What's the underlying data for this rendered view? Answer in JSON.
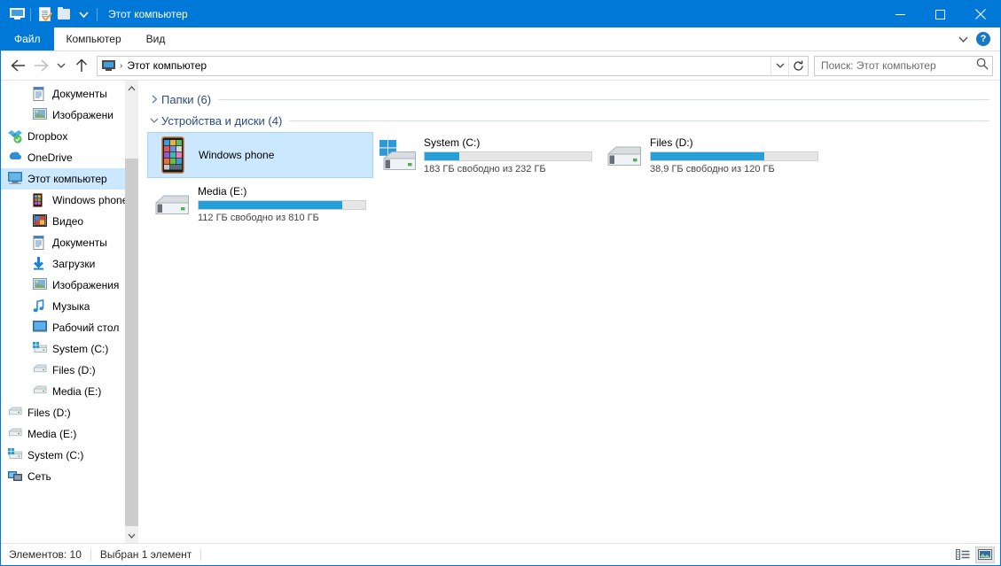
{
  "window": {
    "title": "Этот компьютер",
    "quick_access": [
      "computer-icon",
      "properties-icon",
      "new-folder-icon",
      "customize-chevron-icon"
    ],
    "controls": {
      "minimize": "—",
      "maximize": "▢",
      "close": "✕"
    }
  },
  "ribbon": {
    "tabs": [
      {
        "label": "Файл",
        "active": true
      },
      {
        "label": "Компьютер",
        "active": false
      },
      {
        "label": "Вид",
        "active": false
      }
    ],
    "collapse_icon": "chevron-down-icon",
    "help_label": "?"
  },
  "address": {
    "back_icon": "arrow-left-icon",
    "forward_icon": "arrow-right-icon",
    "recent_icon": "chevron-down-icon",
    "up_icon": "arrow-up-icon",
    "crumb_icon": "computer-icon",
    "path": "Этот компьютер",
    "separator": "›",
    "dropdown_icon": "chevron-down-icon",
    "refresh_icon": "refresh-icon"
  },
  "search": {
    "placeholder": "Поиск: Этот компьютер",
    "icon": "search-icon"
  },
  "sidebar": {
    "items": [
      {
        "label": "Документы",
        "icon": "documents-icon",
        "indent": "ind-1",
        "pinned": true,
        "selected": false
      },
      {
        "label": "Изображени",
        "icon": "pictures-icon",
        "indent": "ind-1",
        "pinned": true,
        "selected": false
      },
      {
        "label": "Dropbox",
        "icon": "dropbox-icon",
        "indent": "ind-top",
        "pinned": false,
        "selected": false
      },
      {
        "label": "OneDrive",
        "icon": "onedrive-icon",
        "indent": "ind-top",
        "pinned": false,
        "selected": false
      },
      {
        "label": "Этот компьютер",
        "icon": "computer-icon",
        "indent": "ind-top",
        "pinned": false,
        "selected": true
      },
      {
        "label": "Windows phone",
        "icon": "phone-icon",
        "indent": "ind-1",
        "pinned": false,
        "selected": false
      },
      {
        "label": "Видео",
        "icon": "video-icon",
        "indent": "ind-1",
        "pinned": false,
        "selected": false
      },
      {
        "label": "Документы",
        "icon": "documents-icon",
        "indent": "ind-1",
        "pinned": false,
        "selected": false
      },
      {
        "label": "Загрузки",
        "icon": "downloads-icon",
        "indent": "ind-1",
        "pinned": false,
        "selected": false
      },
      {
        "label": "Изображения",
        "icon": "pictures-icon",
        "indent": "ind-1",
        "pinned": false,
        "selected": false
      },
      {
        "label": "Музыка",
        "icon": "music-icon",
        "indent": "ind-1",
        "pinned": false,
        "selected": false
      },
      {
        "label": "Рабочий стол",
        "icon": "desktop-icon",
        "indent": "ind-1",
        "pinned": false,
        "selected": false
      },
      {
        "label": "System (C:)",
        "icon": "windows-drive-icon",
        "indent": "ind-1",
        "pinned": false,
        "selected": false
      },
      {
        "label": "Files (D:)",
        "icon": "drive-icon",
        "indent": "ind-1",
        "pinned": false,
        "selected": false
      },
      {
        "label": "Media (E:)",
        "icon": "drive-icon",
        "indent": "ind-1",
        "pinned": false,
        "selected": false
      },
      {
        "label": "Files (D:)",
        "icon": "drive-icon",
        "indent": "ind-top",
        "pinned": false,
        "selected": false
      },
      {
        "label": "Media (E:)",
        "icon": "drive-icon",
        "indent": "ind-top",
        "pinned": false,
        "selected": false
      },
      {
        "label": "System (C:)",
        "icon": "windows-drive-icon",
        "indent": "ind-top",
        "pinned": false,
        "selected": false
      },
      {
        "label": "Сеть",
        "icon": "network-icon",
        "indent": "ind-top",
        "pinned": false,
        "selected": false
      }
    ],
    "scroll_up_icon": "chevron-up-icon",
    "scroll_down_icon": "chevron-down-icon"
  },
  "main": {
    "groups": [
      {
        "title": "Папки (6)",
        "expanded": false,
        "chevron": "chevron-right-icon"
      },
      {
        "title": "Устройства и диски (4)",
        "expanded": true,
        "chevron": "chevron-down-icon"
      }
    ],
    "devices": [
      {
        "name": "Windows phone",
        "icon": "phone-icon",
        "selected": true,
        "has_bar": false,
        "capacity_text": ""
      },
      {
        "name": "System (C:)",
        "icon": "windows-drive-icon",
        "selected": false,
        "has_bar": true,
        "used_percent": 21,
        "capacity_text": "183 ГБ свободно из 232 ГБ"
      },
      {
        "name": "Files (D:)",
        "icon": "drive-icon",
        "selected": false,
        "has_bar": true,
        "used_percent": 68,
        "capacity_text": "38,9 ГБ свободно из 120 ГБ"
      },
      {
        "name": "Media (E:)",
        "icon": "drive-icon",
        "selected": false,
        "has_bar": true,
        "used_percent": 86,
        "capacity_text": "112 ГБ свободно из 810 ГБ"
      }
    ]
  },
  "status": {
    "item_count": "Элементов: 10",
    "selection": "Выбран 1 элемент",
    "view_details_icon": "details-view-icon",
    "view_tiles_icon": "large-icons-view-icon"
  },
  "colors": {
    "accent": "#0078d7",
    "bar_fill": "#26a0da",
    "selection": "#cce8ff",
    "group_header": "#2b4c7e"
  }
}
